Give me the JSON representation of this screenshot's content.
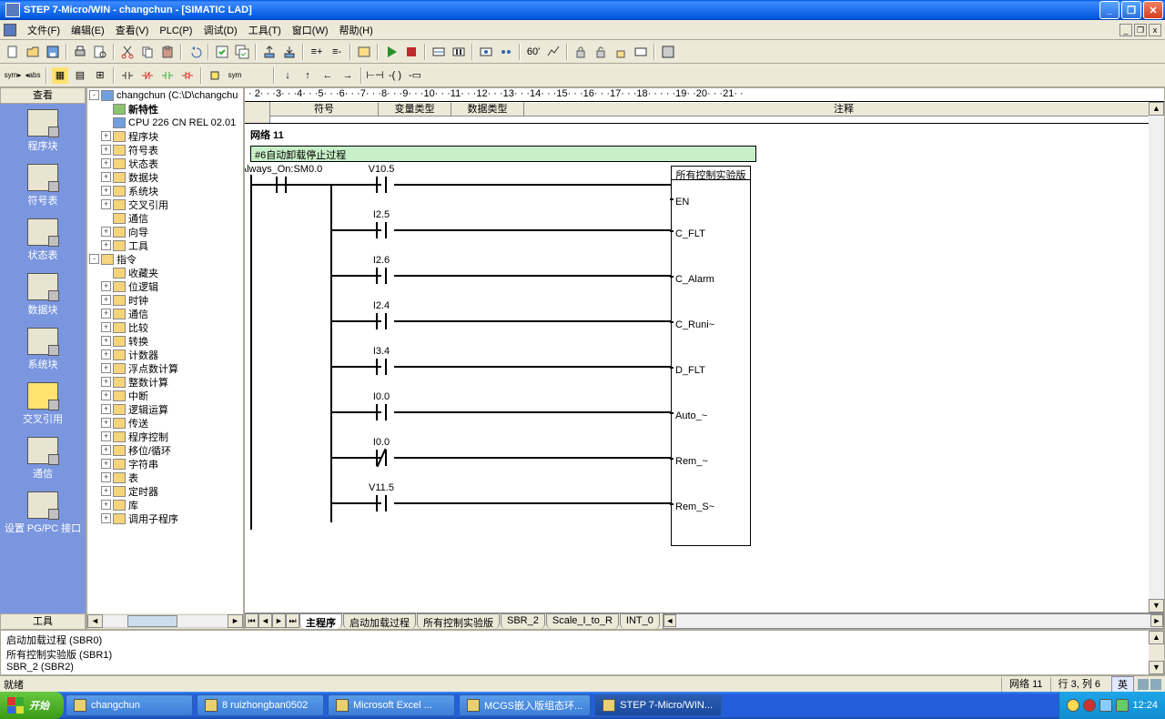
{
  "title": "STEP 7-Micro/WIN - changchun - [SIMATIC LAD]",
  "menu": [
    "文件(F)",
    "编辑(E)",
    "查看(V)",
    "PLC(P)",
    "调试(D)",
    "工具(T)",
    "窗口(W)",
    "帮助(H)"
  ],
  "navbar": {
    "title": "查看",
    "footer": "工具",
    "items": [
      "程序块",
      "符号表",
      "状态表",
      "数据块",
      "系统块",
      "交叉引用",
      "通信",
      "设置 PG/PC 接口"
    ]
  },
  "tree": {
    "root": "changchun (C:\\D\\changchu",
    "nodes": [
      {
        "l": 1,
        "e": "",
        "b": true,
        "t": "新特性",
        "i": "grn"
      },
      {
        "l": 1,
        "e": "",
        "t": "CPU 226 CN REL 02.01",
        "i": "blue"
      },
      {
        "l": 1,
        "e": "+",
        "t": "程序块"
      },
      {
        "l": 1,
        "e": "+",
        "t": "符号表"
      },
      {
        "l": 1,
        "e": "+",
        "t": "状态表"
      },
      {
        "l": 1,
        "e": "+",
        "t": "数据块"
      },
      {
        "l": 1,
        "e": "+",
        "t": "系统块"
      },
      {
        "l": 1,
        "e": "+",
        "t": "交叉引用"
      },
      {
        "l": 1,
        "e": "",
        "t": "通信"
      },
      {
        "l": 1,
        "e": "+",
        "t": "向导"
      },
      {
        "l": 1,
        "e": "+",
        "t": "工具"
      },
      {
        "l": 0,
        "e": "-",
        "t": "指令"
      },
      {
        "l": 1,
        "e": "",
        "t": "收藏夹"
      },
      {
        "l": 1,
        "e": "+",
        "t": "位逻辑"
      },
      {
        "l": 1,
        "e": "+",
        "t": "时钟"
      },
      {
        "l": 1,
        "e": "+",
        "t": "通信"
      },
      {
        "l": 1,
        "e": "+",
        "t": "比较"
      },
      {
        "l": 1,
        "e": "+",
        "t": "转换"
      },
      {
        "l": 1,
        "e": "+",
        "t": "计数器"
      },
      {
        "l": 1,
        "e": "+",
        "t": "浮点数计算"
      },
      {
        "l": 1,
        "e": "+",
        "t": "整数计算"
      },
      {
        "l": 1,
        "e": "+",
        "t": "中断"
      },
      {
        "l": 1,
        "e": "+",
        "t": "逻辑运算"
      },
      {
        "l": 1,
        "e": "+",
        "t": "传送"
      },
      {
        "l": 1,
        "e": "+",
        "t": "程序控制"
      },
      {
        "l": 1,
        "e": "+",
        "t": "移位/循环"
      },
      {
        "l": 1,
        "e": "+",
        "t": "字符串"
      },
      {
        "l": 1,
        "e": "+",
        "t": "表"
      },
      {
        "l": 1,
        "e": "+",
        "t": "定时器"
      },
      {
        "l": 1,
        "e": "+",
        "t": "库"
      },
      {
        "l": 1,
        "e": "+",
        "t": "调用子程序"
      }
    ]
  },
  "ruler": " · 2· · ·3· · ·4· · ·5· · ·6· · ·7· · ·8· · ·9· · ·10· · ·11· · ·12· · ·13· · ·14· · ·15· · ·16· · ·17· · ·18· · · · ·19· ·20· · ·21· ·",
  "vartable": {
    "cols": [
      "符号",
      "变量类型",
      "数据类型",
      "注释"
    ]
  },
  "network": {
    "title": "网络  11",
    "comment": "#6自动卸载停止过程",
    "first_contact": "Always_On:SM0.0",
    "branches": [
      "V10.5",
      "I2.5",
      "I2.6",
      "I2.4",
      "I3.4",
      "I0.0",
      "I0.0",
      "V11.5"
    ],
    "nc_index": 6,
    "box_title": "所有控制实验版",
    "box_rows": [
      "EN",
      "C_FLT",
      "C_Alarm",
      "C_Runi~",
      "D_FLT",
      "Auto_~",
      "Rem_~",
      "Rem_S~"
    ]
  },
  "editor_tabs": [
    "主程序",
    "启动加载过程",
    "所有控制实验版",
    "SBR_2",
    "Scale_I_to_R",
    "INT_0"
  ],
  "output_lines": [
    "启动加载过程 (SBR0)",
    "所有控制实验版 (SBR1)",
    "SBR_2 (SBR2)"
  ],
  "statusbar": {
    "left": "就绪",
    "net": "网络 11",
    "pos": "行 3, 列 6",
    "lang": "英"
  },
  "taskbar": {
    "start": "开始",
    "items": [
      "changchun",
      "8 ruizhongban0502",
      "Microsoft Excel ...",
      "MCGS嵌入版组态环...",
      "STEP 7-Micro/WIN..."
    ],
    "active": 4,
    "time": "12:24"
  }
}
